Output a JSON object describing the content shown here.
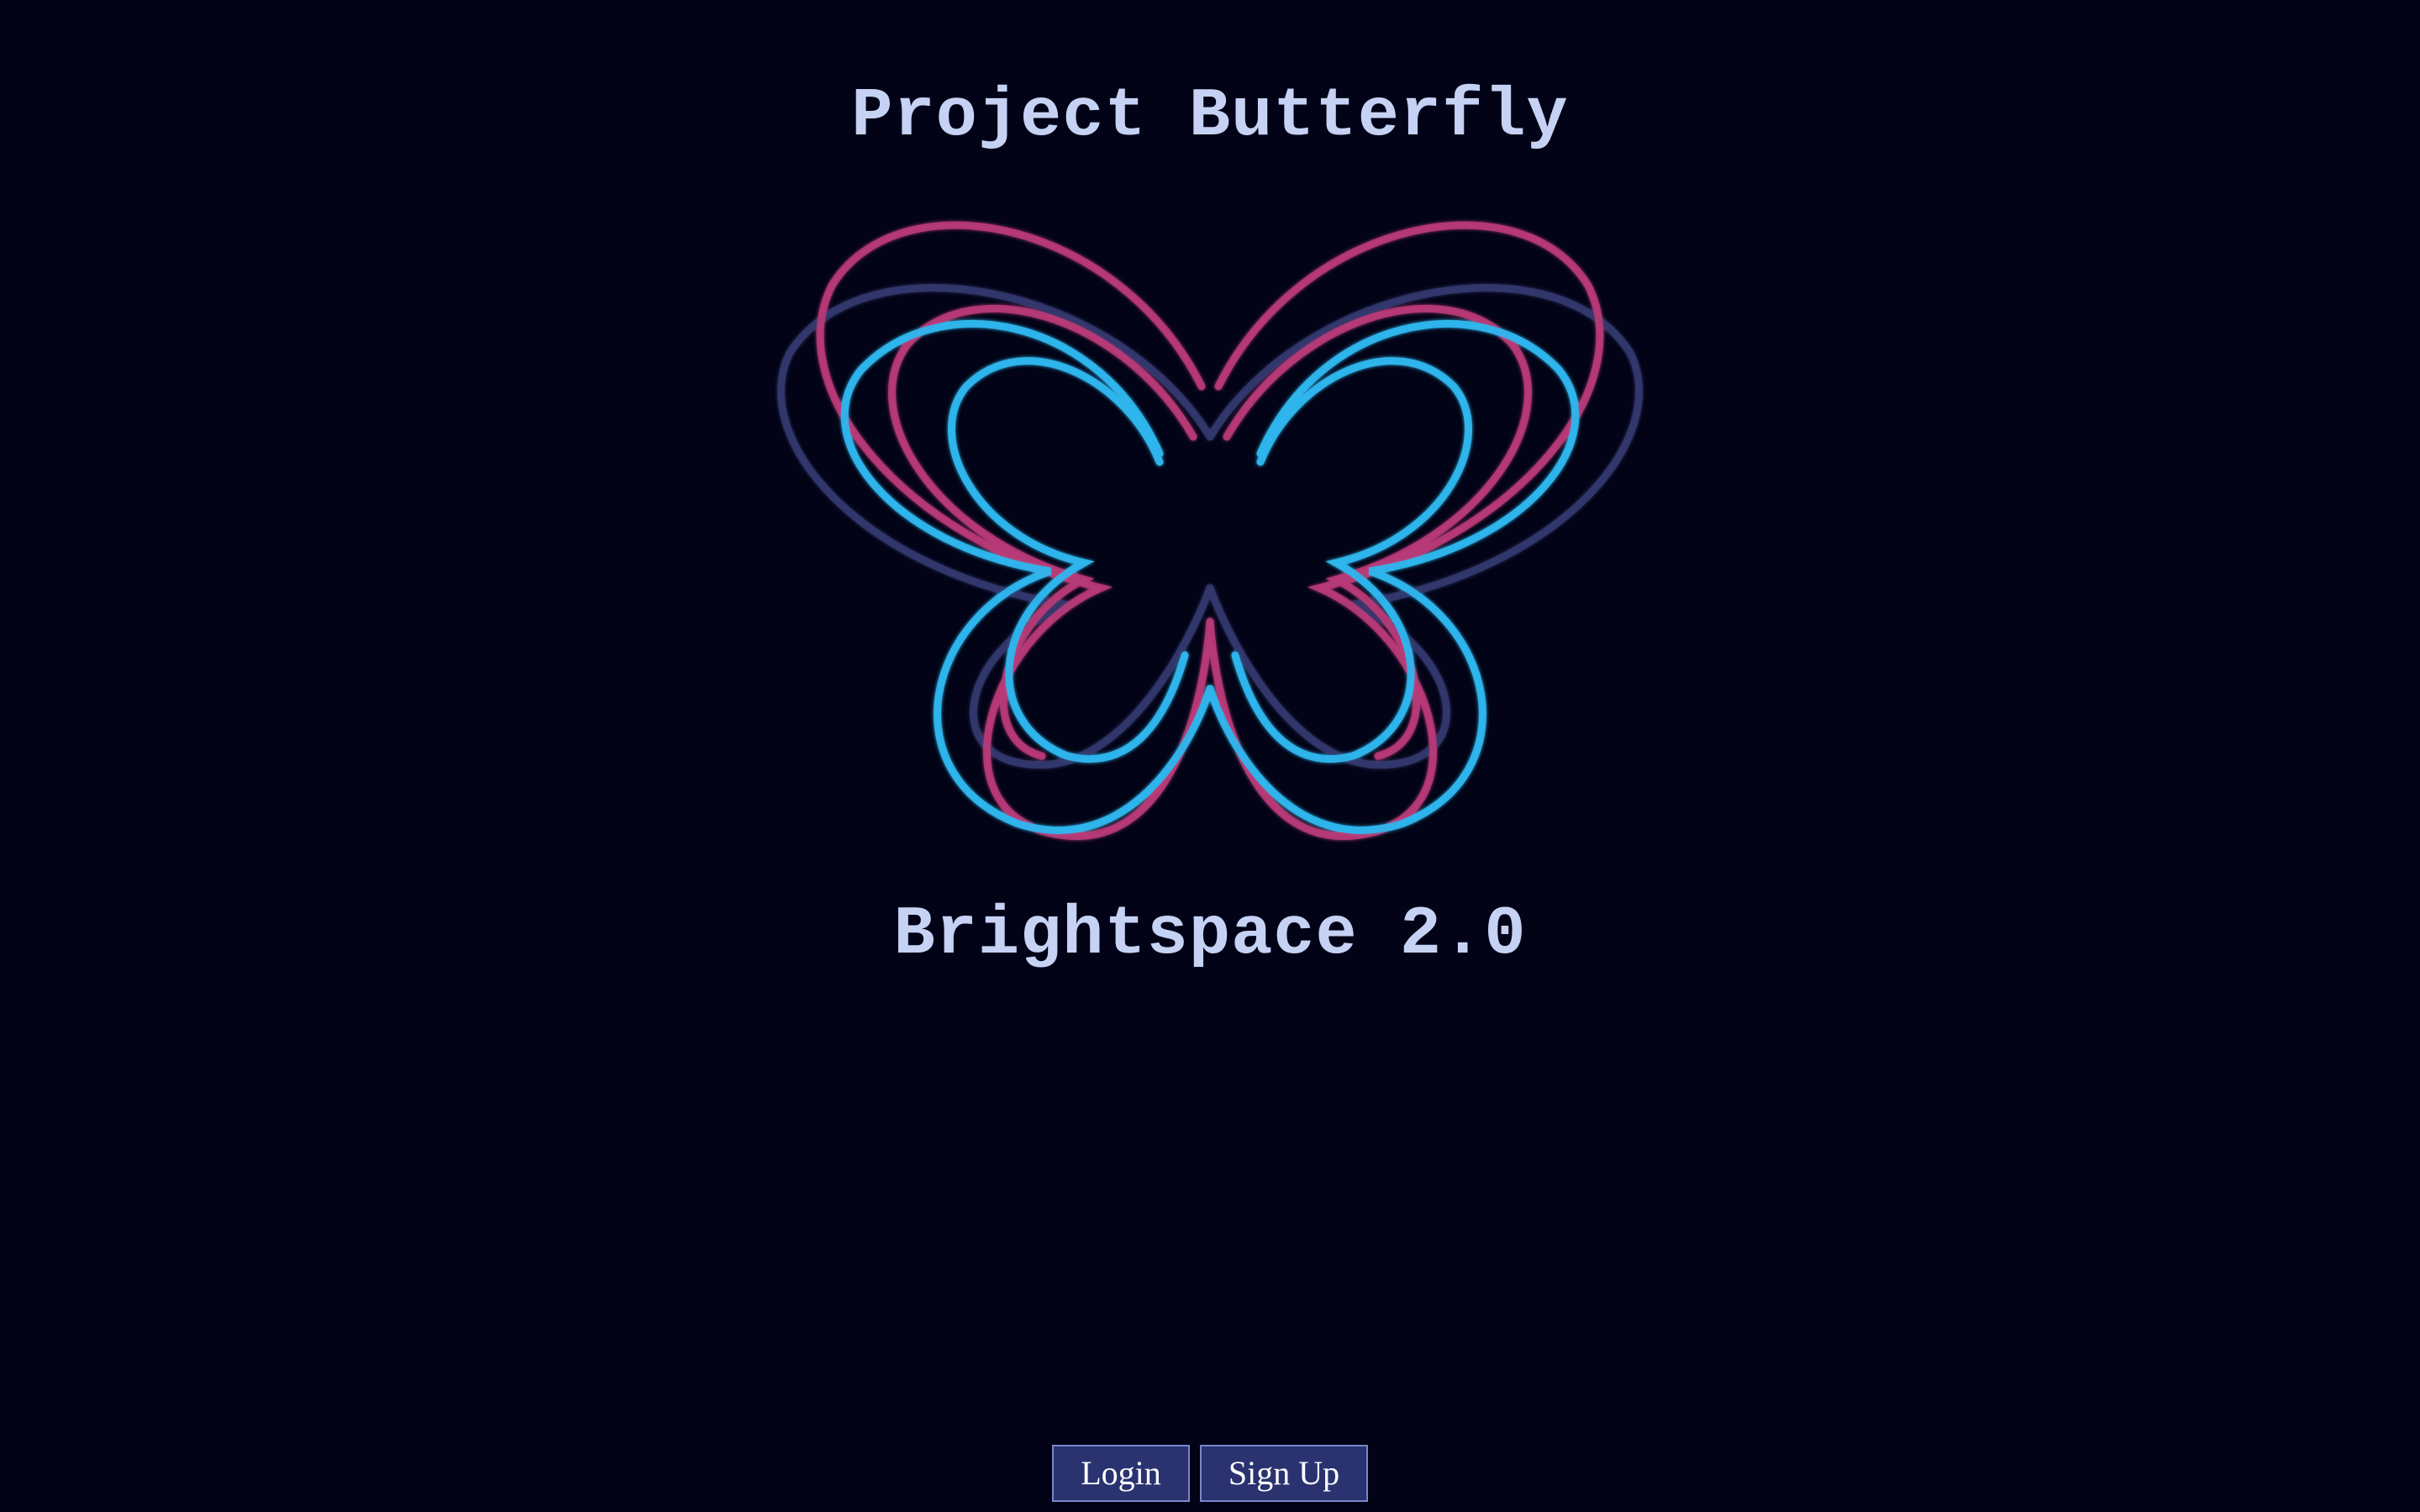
{
  "header": {
    "title": "Project Butterfly"
  },
  "logo": {
    "icon": "butterfly-logo-icon",
    "colors": {
      "pink": "#b83a78",
      "blue": "#2fb6ee",
      "navy": "#34396f"
    }
  },
  "product": {
    "name": "Brightspace 2.0"
  },
  "actions": {
    "login_label": "Login",
    "signup_label": "Sign Up"
  },
  "theme": {
    "background": "#020316",
    "text": "#c6d2f4",
    "button_bg": "#2a3270"
  }
}
